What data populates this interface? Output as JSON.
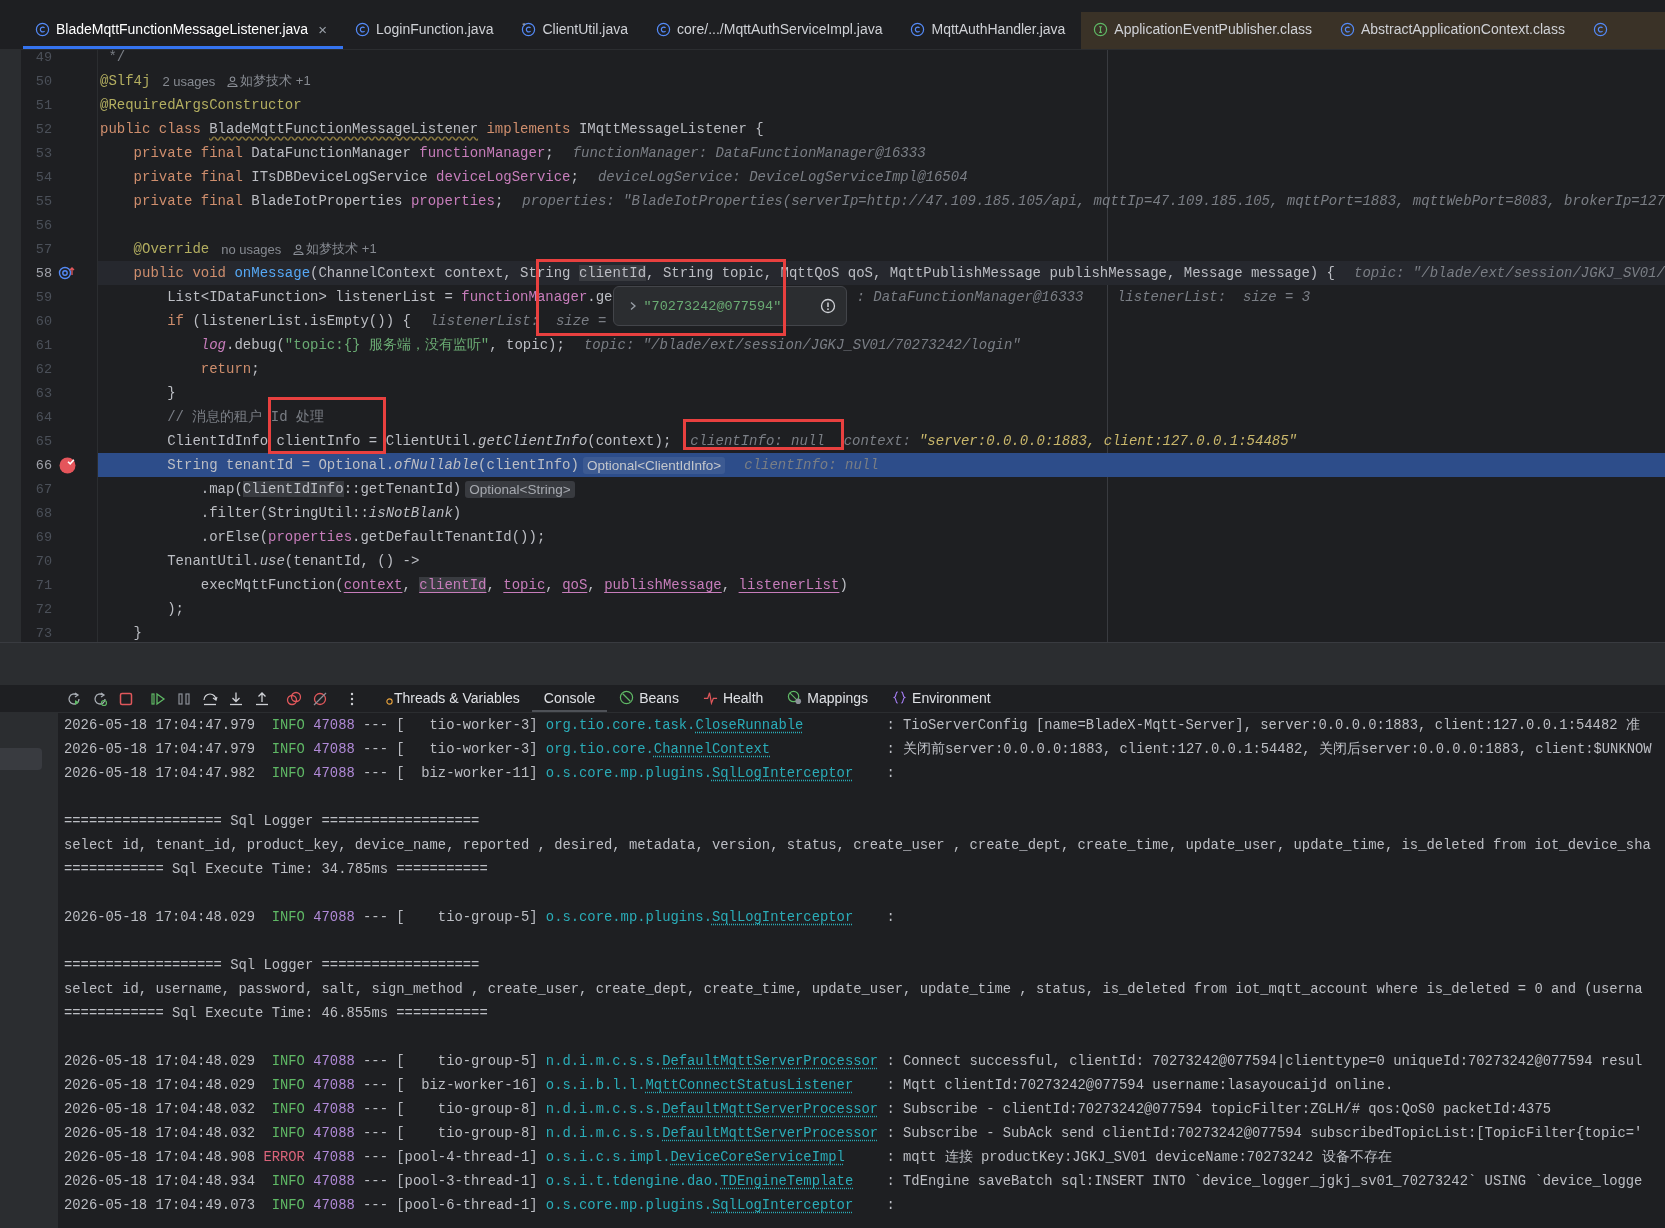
{
  "editor_tabs": [
    {
      "label": "BladeMqttFunctionMessageListener.java",
      "selected": true,
      "read_only": false,
      "close": "×"
    },
    {
      "label": "LoginFunction.java",
      "selected": false,
      "read_only": false
    },
    {
      "label": "ClientUtil.java",
      "selected": false,
      "read_only": false
    },
    {
      "label": "core/.../MqttAuthServiceImpl.java",
      "selected": false,
      "read_only": false
    },
    {
      "label": "MqttAuthHandler.java",
      "selected": false,
      "read_only": false
    },
    {
      "label": "ApplicationEventPublisher.class",
      "selected": false,
      "read_only": true
    },
    {
      "label": "AbstractApplicationContext.class",
      "selected": false,
      "read_only": true
    }
  ],
  "code_lines": [
    {
      "number": "49",
      "caret_line": false,
      "execution_line": false,
      "breakpoint": false,
      "override_marker": false,
      "tokens": [
        {
          "kind": "comment",
          "text": " */"
        }
      ]
    },
    {
      "number": "50",
      "caret_line": false,
      "execution_line": false,
      "breakpoint": false,
      "override_marker": false,
      "tokens": [
        {
          "kind": "annotation",
          "text": "@Slf4j"
        },
        {
          "kind": "meta",
          "text": "2 usages"
        },
        {
          "kind": "author",
          "text": "如梦技术 +1"
        }
      ]
    },
    {
      "number": "51",
      "caret_line": false,
      "execution_line": false,
      "breakpoint": false,
      "override_marker": false,
      "tokens": [
        {
          "kind": "annotation",
          "text": "@RequiredArgsConstructor"
        }
      ]
    },
    {
      "number": "52",
      "caret_line": false,
      "execution_line": false,
      "breakpoint": false,
      "override_marker": false,
      "tokens": [
        {
          "kind": "keyword",
          "text": "public class "
        },
        {
          "kind": "typo",
          "text": "BladeMqttFunctionMessageListener"
        },
        {
          "kind": "keyword",
          "text": " implements "
        },
        {
          "kind": "plain",
          "text": "IMqttMessageListener {"
        }
      ]
    },
    {
      "number": "53",
      "caret_line": false,
      "execution_line": false,
      "breakpoint": false,
      "override_marker": false,
      "tokens": [
        {
          "kind": "keyword",
          "text": "    private final "
        },
        {
          "kind": "plain",
          "text": "DataFunctionManager "
        },
        {
          "kind": "field",
          "text": "functionManager"
        },
        {
          "kind": "plain",
          "text": ";"
        },
        {
          "kind": "hint",
          "text": "functionManager: DataFunctionManager@16333"
        }
      ]
    },
    {
      "number": "54",
      "caret_line": false,
      "execution_line": false,
      "breakpoint": false,
      "override_marker": false,
      "tokens": [
        {
          "kind": "keyword",
          "text": "    private final "
        },
        {
          "kind": "plain",
          "text": "ITsDBDeviceLogService "
        },
        {
          "kind": "field",
          "text": "deviceLogService"
        },
        {
          "kind": "plain",
          "text": ";"
        },
        {
          "kind": "hint",
          "text": "deviceLogService: DeviceLogServiceImpl@16504"
        }
      ]
    },
    {
      "number": "55",
      "caret_line": false,
      "execution_line": false,
      "breakpoint": false,
      "override_marker": false,
      "tokens": [
        {
          "kind": "keyword",
          "text": "    private final "
        },
        {
          "kind": "plain",
          "text": "BladeIotProperties "
        },
        {
          "kind": "field",
          "text": "properties"
        },
        {
          "kind": "plain",
          "text": ";"
        },
        {
          "kind": "hint",
          "text": "properties: \"BladeIotProperties(serverIp=http://47.109.185.105/api, mqttIp=47.109.185.105, mqttPort=1883, mqttWebPort=8083, brokerIp=127"
        }
      ]
    },
    {
      "number": "56",
      "caret_line": false,
      "execution_line": false,
      "breakpoint": false,
      "override_marker": false
    },
    {
      "number": "57",
      "caret_line": false,
      "execution_line": false,
      "breakpoint": false,
      "override_marker": false,
      "tokens": [
        {
          "kind": "annotation",
          "text": "    @Override"
        },
        {
          "kind": "meta",
          "text": "no usages"
        },
        {
          "kind": "author",
          "text": "如梦技术 +1"
        }
      ]
    },
    {
      "number": "58",
      "caret_line": true,
      "execution_line": false,
      "breakpoint": false,
      "override_marker": true,
      "tokens": [
        {
          "kind": "keyword",
          "text": "    public void "
        },
        {
          "kind": "method",
          "text": "onMessage"
        },
        {
          "kind": "plain",
          "text": "(ChannelContext context, String "
        },
        {
          "kind": "mark",
          "text": "clientId"
        },
        {
          "kind": "plain",
          "text": ", String topic, MqttQoS qoS, MqttPublishMessage publishMessage, Message message) {"
        },
        {
          "kind": "hint",
          "text": "topic: \"/blade/ext/session/JGKJ_SV01/"
        }
      ]
    },
    {
      "number": "59",
      "caret_line": false,
      "execution_line": false,
      "breakpoint": false,
      "override_marker": false,
      "tokens": [
        {
          "kind": "plain",
          "text": "        List<IDataFunction> listenerList = "
        },
        {
          "kind": "field",
          "text": "functionManager"
        },
        {
          "kind": "plain",
          "text": ".ge"
        },
        {
          "kind": "popup",
          "text": "\"70273242@077594\""
        },
        {
          "kind": "hint",
          "text": ": DataFunctionManager@16333    listenerList:  size = 3"
        }
      ]
    },
    {
      "number": "60",
      "caret_line": false,
      "execution_line": false,
      "breakpoint": false,
      "override_marker": false,
      "tokens": [
        {
          "kind": "keyword",
          "text": "        if "
        },
        {
          "kind": "plain",
          "text": "(listenerList.isEmpty()) {"
        },
        {
          "kind": "hint",
          "text": "listenerList:  size ="
        }
      ]
    },
    {
      "number": "61",
      "caret_line": false,
      "execution_line": false,
      "breakpoint": false,
      "override_marker": false,
      "tokens": [
        {
          "kind": "static",
          "text": "            log"
        },
        {
          "kind": "plain",
          "text": ".debug("
        },
        {
          "kind": "string",
          "text": "\"topic:{} 服务端，没有监听\""
        },
        {
          "kind": "plain",
          "text": ", topic);"
        },
        {
          "kind": "hint",
          "text": "topic: \"/blade/ext/session/JGKJ_SV01/70273242/login\""
        }
      ]
    },
    {
      "number": "62",
      "caret_line": false,
      "execution_line": false,
      "breakpoint": false,
      "override_marker": false,
      "tokens": [
        {
          "kind": "keyword",
          "text": "            return"
        },
        {
          "kind": "plain",
          "text": ";"
        }
      ]
    },
    {
      "number": "63",
      "caret_line": false,
      "execution_line": false,
      "breakpoint": false,
      "override_marker": false,
      "tokens": [
        {
          "kind": "plain",
          "text": "        }"
        }
      ]
    },
    {
      "number": "64",
      "caret_line": false,
      "execution_line": false,
      "breakpoint": false,
      "override_marker": false,
      "tokens": [
        {
          "kind": "comment",
          "text": "        // 消息的租户 Id 处理"
        }
      ]
    },
    {
      "number": "65",
      "caret_line": false,
      "execution_line": false,
      "breakpoint": false,
      "override_marker": false,
      "tokens": [
        {
          "kind": "plain",
          "text": "        ClientIdInfo clientInfo = ClientUtil."
        },
        {
          "kind": "italic",
          "text": "getClientInfo"
        },
        {
          "kind": "plain",
          "text": "(context);"
        },
        {
          "kind": "hint",
          "text": "clientInfo: null"
        },
        {
          "kind": "hint",
          "text": "context:"
        },
        {
          "kind": "hint_value",
          "text": "\"server:0.0.0.0:1883, client:127.0.0.1:54485\""
        }
      ]
    },
    {
      "number": "66",
      "caret_line": false,
      "execution_line": true,
      "breakpoint": true,
      "override_marker": false,
      "tokens": [
        {
          "kind": "plain",
          "text": "        String tenantId = Optional."
        },
        {
          "kind": "italic",
          "text": "ofNullable"
        },
        {
          "kind": "plain",
          "text": "(clientInfo)"
        },
        {
          "kind": "chip",
          "text": "Optional<ClientIdInfo>"
        },
        {
          "kind": "hint",
          "text": "clientInfo: null"
        }
      ]
    },
    {
      "number": "67",
      "caret_line": false,
      "execution_line": false,
      "breakpoint": false,
      "override_marker": false,
      "tokens": [
        {
          "kind": "plain",
          "text": "            .map("
        },
        {
          "kind": "mark",
          "text": "ClientIdInfo"
        },
        {
          "kind": "plain",
          "text": "::getTenantId)"
        },
        {
          "kind": "chip",
          "text": "Optional<String>"
        }
      ]
    },
    {
      "number": "68",
      "caret_line": false,
      "execution_line": false,
      "breakpoint": false,
      "override_marker": false,
      "tokens": [
        {
          "kind": "plain",
          "text": "            .filter(StringUtil::"
        },
        {
          "kind": "italic",
          "text": "isNotBlank"
        },
        {
          "kind": "plain",
          "text": ")"
        }
      ]
    },
    {
      "number": "69",
      "caret_line": false,
      "execution_line": false,
      "breakpoint": false,
      "override_marker": false,
      "tokens": [
        {
          "kind": "plain",
          "text": "            .orElse("
        },
        {
          "kind": "field",
          "text": "properties"
        },
        {
          "kind": "plain",
          "text": ".getDefaultTenantId());"
        }
      ]
    },
    {
      "number": "70",
      "caret_line": false,
      "execution_line": false,
      "breakpoint": false,
      "override_marker": false,
      "tokens": [
        {
          "kind": "plain",
          "text": "        TenantUtil."
        },
        {
          "kind": "italic",
          "text": "use"
        },
        {
          "kind": "plain",
          "text": "(tenantId, () ->"
        }
      ]
    },
    {
      "number": "71",
      "caret_line": false,
      "execution_line": false,
      "breakpoint": false,
      "override_marker": false,
      "tokens": [
        {
          "kind": "plain",
          "text": "            execMqttFunction("
        },
        {
          "kind": "field_link",
          "text": "context"
        },
        {
          "kind": "plain",
          "text": ", "
        },
        {
          "kind": "mark_link",
          "text": "clientId"
        },
        {
          "kind": "plain",
          "text": ", "
        },
        {
          "kind": "field_link",
          "text": "topic"
        },
        {
          "kind": "plain",
          "text": ", "
        },
        {
          "kind": "field_link",
          "text": "qoS"
        },
        {
          "kind": "plain",
          "text": ", "
        },
        {
          "kind": "field_link",
          "text": "publishMessage"
        },
        {
          "kind": "plain",
          "text": ", "
        },
        {
          "kind": "field_link",
          "text": "listenerList"
        },
        {
          "kind": "plain",
          "text": ")"
        }
      ]
    },
    {
      "number": "72",
      "caret_line": false,
      "execution_line": false,
      "breakpoint": false,
      "override_marker": false,
      "tokens": [
        {
          "kind": "plain",
          "text": "        );"
        }
      ]
    },
    {
      "number": "73",
      "caret_line": false,
      "execution_line": false,
      "breakpoint": false,
      "override_marker": false,
      "tokens": [
        {
          "kind": "plain",
          "text": "    }"
        }
      ]
    }
  ],
  "debug_tabs": [
    {
      "label": "Threads & Variables",
      "selected": false
    },
    {
      "label": "Console",
      "selected": true
    },
    {
      "label": "Beans",
      "selected": false
    },
    {
      "label": "Health",
      "selected": false
    },
    {
      "label": "Mappings",
      "selected": false
    },
    {
      "label": "Environment",
      "selected": false
    }
  ],
  "console_lines": [
    {
      "kind": "log",
      "time": "2026-05-18 17:04:47.979",
      "error": false,
      "level": "INFO",
      "pid": "47088",
      "sep": "---",
      "thread": "[   tio-worker-3]",
      "logger_package": "org.tio.core.task.",
      "logger_class": "CloseRunnable",
      "message": ": TioServerConfig [name=BladeX-Mqtt-Server], server:0.0.0.0:1883, client:127.0.0.1:54482 准"
    },
    {
      "kind": "log",
      "time": "2026-05-18 17:04:47.979",
      "error": false,
      "level": "INFO",
      "pid": "47088",
      "sep": "---",
      "thread": "[   tio-worker-3]",
      "logger_package": "org.tio.core.",
      "logger_class": "ChannelContext",
      "message": ": 关闭前server:0.0.0.0:1883, client:127.0.0.1:54482, 关闭后server:0.0.0.0:1883, client:$UNKNOW"
    },
    {
      "kind": "log",
      "time": "2026-05-18 17:04:47.982",
      "error": false,
      "level": "INFO",
      "pid": "47088",
      "sep": "---",
      "thread": "[  biz-worker-11]",
      "logger_package": "o.s.core.mp.plugins.",
      "logger_class": "SqlLogInterceptor",
      "message": ":"
    },
    {
      "kind": "blank"
    },
    {
      "kind": "text",
      "text": "=================== Sql Logger ==================="
    },
    {
      "kind": "text",
      "text": "select id, tenant_id, product_key, device_name, reported , desired, metadata, version, status, create_user , create_dept, create_time, update_user, update_time, is_deleted from iot_device_sha"
    },
    {
      "kind": "text",
      "text": "============ Sql Execute Time: 34.785ms ==========="
    },
    {
      "kind": "blank"
    },
    {
      "kind": "log",
      "time": "2026-05-18 17:04:48.029",
      "error": false,
      "level": "INFO",
      "pid": "47088",
      "sep": "---",
      "thread": "[    tio-group-5]",
      "logger_package": "o.s.core.mp.plugins.",
      "logger_class": "SqlLogInterceptor",
      "message": ":"
    },
    {
      "kind": "blank"
    },
    {
      "kind": "text",
      "text": "=================== Sql Logger ==================="
    },
    {
      "kind": "text",
      "text": "select id, username, password, salt, sign_method , create_user, create_dept, create_time, update_user, update_time , status, is_deleted from iot_mqtt_account where is_deleted = 0 and (userna"
    },
    {
      "kind": "text",
      "text": "============ Sql Execute Time: 46.855ms ==========="
    },
    {
      "kind": "blank"
    },
    {
      "kind": "log",
      "time": "2026-05-18 17:04:48.029",
      "error": false,
      "level": "INFO",
      "pid": "47088",
      "sep": "---",
      "thread": "[    tio-group-5]",
      "logger_package": "n.d.i.m.c.s.s.",
      "logger_class": "DefaultMqttServerProcessor",
      "message": ": Connect successful, clientId: 70273242@077594|clienttype=0 uniqueId:70273242@077594 resul"
    },
    {
      "kind": "log",
      "time": "2026-05-18 17:04:48.029",
      "error": false,
      "level": "INFO",
      "pid": "47088",
      "sep": "---",
      "thread": "[  biz-worker-16]",
      "logger_package": "o.s.i.b.l.l.",
      "logger_class": "MqttConnectStatusListener",
      "message": ": Mqtt clientId:70273242@077594 username:lasayoucaijd online."
    },
    {
      "kind": "log",
      "time": "2026-05-18 17:04:48.032",
      "error": false,
      "level": "INFO",
      "pid": "47088",
      "sep": "---",
      "thread": "[    tio-group-8]",
      "logger_package": "n.d.i.m.c.s.s.",
      "logger_class": "DefaultMqttServerProcessor",
      "message": ": Subscribe - clientId:70273242@077594 topicFilter:ZGLH/# qos:QoS0 packetId:4375"
    },
    {
      "kind": "log",
      "time": "2026-05-18 17:04:48.032",
      "error": false,
      "level": "INFO",
      "pid": "47088",
      "sep": "---",
      "thread": "[    tio-group-8]",
      "logger_package": "n.d.i.m.c.s.s.",
      "logger_class": "DefaultMqttServerProcessor",
      "message": ": Subscribe - SubAck send clientId:70273242@077594 subscribedTopicList:[TopicFilter{topic='"
    },
    {
      "kind": "log",
      "time": "2026-05-18 17:04:48.908",
      "error": true,
      "level": "ERROR",
      "pid": "47088",
      "sep": "---",
      "thread": "[pool-4-thread-1]",
      "logger_package": "o.s.i.c.s.impl.",
      "logger_class": "DeviceCoreServiceImpl",
      "message": ": mqtt 连接 productKey:JGKJ_SV01 deviceName:70273242 设备不存在"
    },
    {
      "kind": "log",
      "time": "2026-05-18 17:04:48.934",
      "error": false,
      "level": "INFO",
      "pid": "47088",
      "sep": "---",
      "thread": "[pool-3-thread-1]",
      "logger_package": "o.s.i.t.tdengine.dao.",
      "logger_class": "TDEngineTemplate",
      "message": ": TdEngine saveBatch sql:INSERT INTO `device_logger_jgkj_sv01_70273242` USING `device_logge"
    },
    {
      "kind": "log",
      "time": "2026-05-18 17:04:49.073",
      "error": false,
      "level": "INFO",
      "pid": "47088",
      "sep": "---",
      "thread": "[pool-6-thread-1]",
      "logger_package": "o.s.core.mp.plugins.",
      "logger_class": "SqlLogInterceptor",
      "message": ":"
    }
  ]
}
